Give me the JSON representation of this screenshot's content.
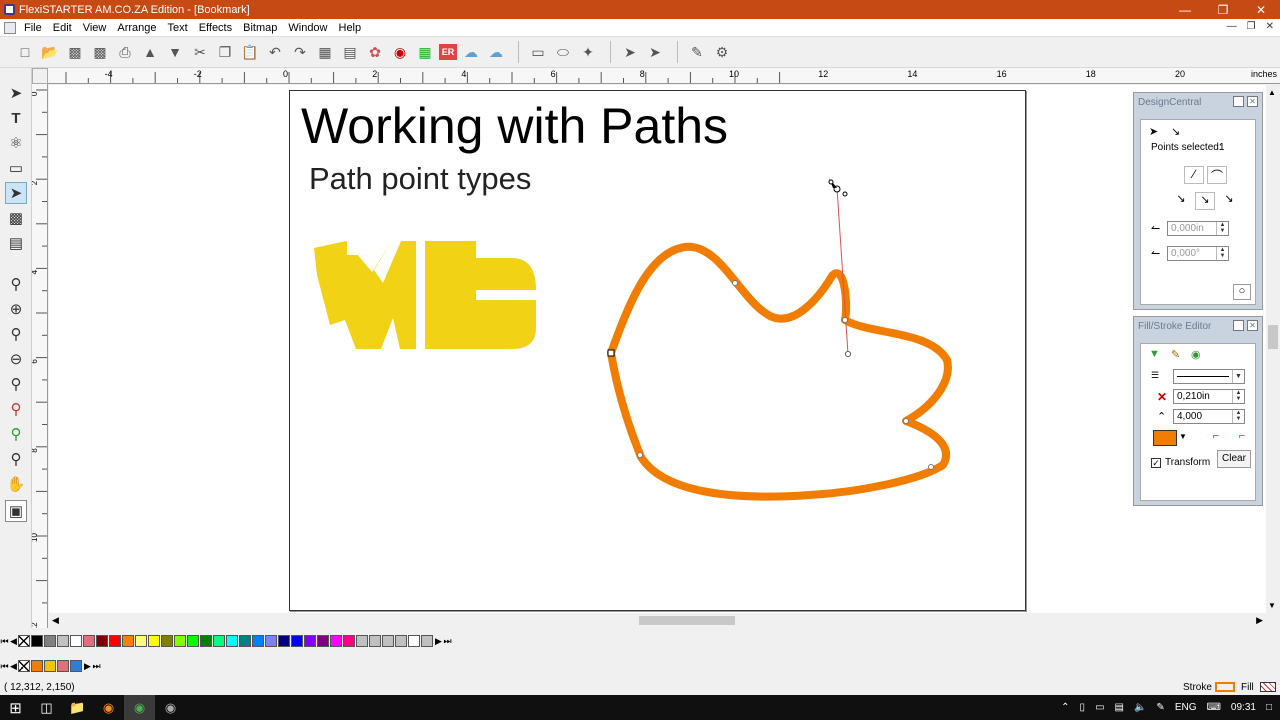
{
  "window": {
    "title": "FlexiSTARTER AM.CO.ZA Edition - [Bookmark]"
  },
  "menu": [
    "File",
    "Edit",
    "View",
    "Arrange",
    "Text",
    "Effects",
    "Bitmap",
    "Window",
    "Help"
  ],
  "toolbar_icons": [
    "new",
    "open",
    "save",
    "save-as",
    "print",
    "cut-vinyl",
    "cut",
    "copy",
    "paste",
    "undo",
    "redo",
    "align",
    "layers",
    "color-wheel",
    "spot-color",
    "color-palette",
    "er",
    "cloud",
    "cloud-upload",
    "rectangle",
    "ellipse",
    "pen",
    "select",
    "node-edit",
    "knife",
    "weed"
  ],
  "ruler": {
    "unit": "inches",
    "h_ticks": [
      "-4",
      "-2",
      "0",
      "2",
      "4",
      "6",
      "8",
      "10",
      "12",
      "14",
      "16",
      "18",
      "20"
    ],
    "v_ticks": [
      "0",
      "2",
      "4",
      "6",
      "8",
      "10",
      "12"
    ]
  },
  "document": {
    "heading": "Working with Paths",
    "subheading": "Path point types",
    "logo_text": "WB"
  },
  "design_central": {
    "title": "DesignCentral",
    "points_selected_label": "Points selected:",
    "points_selected_value": "1",
    "length_value": "0,000in",
    "angle_value": "0,000°"
  },
  "fill_stroke": {
    "title": "Fill/Stroke Editor",
    "width_value": "0,210in",
    "miter_value": "4,000",
    "stroke_color": "#f07d00",
    "transform_label": "Transform",
    "transform_checked": true,
    "clear_label": "Clear"
  },
  "palette_colors": [
    "#000000",
    "#808080",
    "#c0c0c0",
    "#ffffff",
    "#e0707a",
    "#800000",
    "#ff0000",
    "#ff8000",
    "#ffff80",
    "#ffff00",
    "#808000",
    "#80ff00",
    "#00ff00",
    "#008000",
    "#00ff80",
    "#00ffff",
    "#008080",
    "#0080ff",
    "#8080ff",
    "#000080",
    "#0000ff",
    "#8000ff",
    "#800080",
    "#ff00ff",
    "#ff0080",
    "#c0c0c0",
    "#c0c0c0",
    "#c0c0c0",
    "#c0c0c0",
    "#ffffff",
    "#c0c0c0"
  ],
  "doc_colors": [
    "#f07d00",
    "#f5c400",
    "#e0707a",
    "#2f7fd8"
  ],
  "status": {
    "coords": "( 12,312,     2,150)",
    "stroke_label": "Stroke",
    "fill_label": "Fill"
  },
  "taskbar": {
    "lang": "ENG",
    "time": "09:31"
  },
  "colors": {
    "title_bar": "#c64a14",
    "logo_yellow": "#f2d214",
    "path_orange": "#f07d00"
  }
}
